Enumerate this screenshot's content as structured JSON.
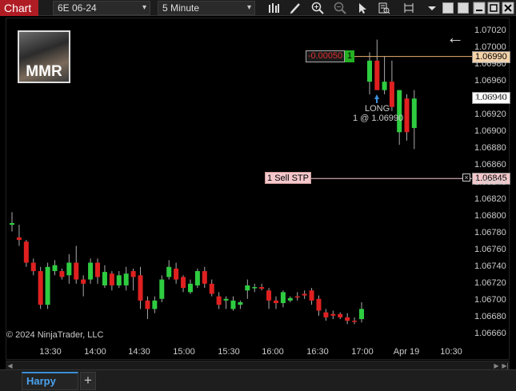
{
  "toolbar": {
    "chart_label": "Chart",
    "instrument": "6E 06-24",
    "interval": "5 Minute",
    "icons": [
      "bar-style-icon",
      "draw-tool-icon",
      "zoom-in-icon",
      "zoom-out-icon",
      "pointer-icon",
      "data-box-icon",
      "properties-icon",
      "dropdown-icon"
    ]
  },
  "overlay": {
    "copyright": "© 2024 NinjaTrader, LLC",
    "logo_text": "MMR",
    "position_pnl": "-0.00050",
    "position_qty": "1",
    "stop_order_label": "1 Sell STP",
    "entry_label": "LONG",
    "entry_detail": "1 @ 1.06990"
  },
  "price_markers": {
    "entry": "1.06990",
    "last": "1.06940",
    "stop": "1.06845"
  },
  "colors": {
    "up": "#2ecc40",
    "down": "#e02020",
    "entry_line": "#e8b070",
    "stop_line": "#f4c8cc",
    "tab_accent": "#3a8fd9"
  },
  "tabs": {
    "active": "Harpy",
    "add": "+"
  },
  "chart_data": {
    "type": "candlestick",
    "y_ticks": [
      "1.07020",
      "1.07000",
      "1.06980",
      "1.06960",
      "1.06940",
      "1.06920",
      "1.06900",
      "1.06880",
      "1.06860",
      "1.06840",
      "1.06820",
      "1.06800",
      "1.06780",
      "1.06760",
      "1.06740",
      "1.06720",
      "1.06700",
      "1.06680",
      "1.06660"
    ],
    "x_ticks": [
      "13:30",
      "14:00",
      "14:30",
      "15:00",
      "15:30",
      "16:00",
      "16:30",
      "17:00",
      "Apr 19",
      "10:30"
    ],
    "ylim": [
      1.0665,
      1.0704
    ],
    "candles": [
      [
        1.0679,
        1.06805,
        1.06782,
        1.06792
      ],
      [
        1.06775,
        1.0679,
        1.06765,
        1.06772
      ],
      [
        1.0677,
        1.06772,
        1.0674,
        1.06745
      ],
      [
        1.06745,
        1.0675,
        1.0673,
        1.06735
      ],
      [
        1.06735,
        1.0674,
        1.0669,
        1.06695
      ],
      [
        1.06695,
        1.06745,
        1.0669,
        1.0674
      ],
      [
        1.06735,
        1.06748,
        1.0673,
        1.06742
      ],
      [
        1.06735,
        1.06738,
        1.06725,
        1.06728
      ],
      [
        1.0673,
        1.06755,
        1.0672,
        1.06745
      ],
      [
        1.06745,
        1.06765,
        1.0672,
        1.06725
      ],
      [
        1.06725,
        1.0673,
        1.06705,
        1.0672
      ],
      [
        1.06725,
        1.0675,
        1.0672,
        1.06745
      ],
      [
        1.06745,
        1.0675,
        1.0672,
        1.06728
      ],
      [
        1.06718,
        1.06742,
        1.06715,
        1.06734
      ],
      [
        1.06732,
        1.06735,
        1.06712,
        1.06718
      ],
      [
        1.06718,
        1.06735,
        1.06715,
        1.0673
      ],
      [
        1.06718,
        1.0674,
        1.06712,
        1.06732
      ],
      [
        1.06735,
        1.06738,
        1.06712,
        1.06728
      ],
      [
        1.0673,
        1.0674,
        1.0669,
        1.067
      ],
      [
        1.067,
        1.06705,
        1.06678,
        1.0669
      ],
      [
        1.0669,
        1.06705,
        1.06685,
        1.067
      ],
      [
        1.06702,
        1.0673,
        1.06698,
        1.06725
      ],
      [
        1.06728,
        1.06748,
        1.06725,
        1.0674
      ],
      [
        1.06738,
        1.06745,
        1.0672,
        1.06725
      ],
      [
        1.06728,
        1.0673,
        1.0671,
        1.06715
      ],
      [
        1.0671,
        1.06725,
        1.06708,
        1.0672
      ],
      [
        1.06718,
        1.06738,
        1.06715,
        1.06735
      ],
      [
        1.06735,
        1.0674,
        1.06715,
        1.0672
      ],
      [
        1.0672,
        1.06725,
        1.06705,
        1.06708
      ],
      [
        1.06705,
        1.0671,
        1.0669,
        1.06695
      ],
      [
        1.067,
        1.06705,
        1.0669,
        1.06702
      ],
      [
        1.0669,
        1.06705,
        1.06688,
        1.067
      ],
      [
        1.06695,
        1.067,
        1.0669,
        1.06698
      ],
      [
        1.06712,
        1.06725,
        1.06702,
        1.06718
      ],
      [
        1.06715,
        1.0672,
        1.0671,
        1.06716
      ],
      [
        1.06716,
        1.0672,
        1.06712,
        1.06714
      ],
      [
        1.06712,
        1.06715,
        1.0669,
        1.067
      ],
      [
        1.067,
        1.06705,
        1.0669,
        1.06697
      ],
      [
        1.06697,
        1.06712,
        1.06692,
        1.0671
      ],
      [
        1.067,
        1.06705,
        1.06698,
        1.06703
      ],
      [
        1.06705,
        1.0671,
        1.067,
        1.06704
      ],
      [
        1.06708,
        1.06712,
        1.06702,
        1.06706
      ],
      [
        1.06712,
        1.06715,
        1.06695,
        1.067
      ],
      [
        1.06702,
        1.06706,
        1.06682,
        1.06688
      ],
      [
        1.06686,
        1.0669,
        1.06676,
        1.0668
      ],
      [
        1.06684,
        1.06688,
        1.06678,
        1.06682
      ],
      [
        1.06684,
        1.06686,
        1.06678,
        1.0668
      ],
      [
        1.0668,
        1.06685,
        1.06672,
        1.06676
      ],
      [
        1.06676,
        1.0668,
        1.06672,
        1.06675
      ],
      [
        1.06678,
        1.06698,
        1.06674,
        1.0669
      ]
    ],
    "recent_candles": [
      [
        1.0696,
        1.06995,
        1.06945,
        1.06985
      ],
      [
        1.06985,
        1.0701,
        1.0695,
        1.0695
      ],
      [
        1.0695,
        1.0699,
        1.06945,
        1.0696
      ],
      [
        1.0696,
        1.06985,
        1.06925,
        1.0693
      ],
      [
        1.069,
        1.0695,
        1.06885,
        1.0695
      ],
      [
        1.0694,
        1.06945,
        1.0689,
        1.069
      ],
      [
        1.06905,
        1.0695,
        1.0688,
        1.0694
      ]
    ]
  }
}
